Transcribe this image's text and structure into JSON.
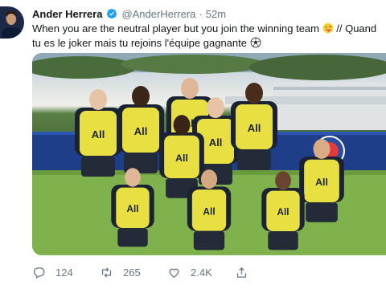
{
  "tweet": {
    "author": {
      "display_name": "Ander Herrera",
      "verified_icon": "verified-badge-icon",
      "handle": "@AnderHerrera",
      "separator": "·",
      "time": "52m"
    },
    "text_lines": [
      "When you are the neutral player but you join the winning team",
      "tu es le joker mais tu rejoins l'équipe gagnante"
    ],
    "text_line1_suffix": " // Quand",
    "emojis": [
      "winking-tongue-face-emoji",
      "soccer-ball-emoji"
    ],
    "media": {
      "description_icon": "team-photo",
      "shirt_text": "All",
      "colors": {
        "bib": "#e8e043",
        "grass": "#7fae4e",
        "shirt": "#1b2233"
      }
    },
    "actions": {
      "reply_count": "124",
      "retweet_count": "265",
      "like_count": "2.4K"
    }
  },
  "colors": {
    "text_primary": "#14171a",
    "text_secondary": "#657786",
    "verified_blue": "#1da1f2"
  }
}
